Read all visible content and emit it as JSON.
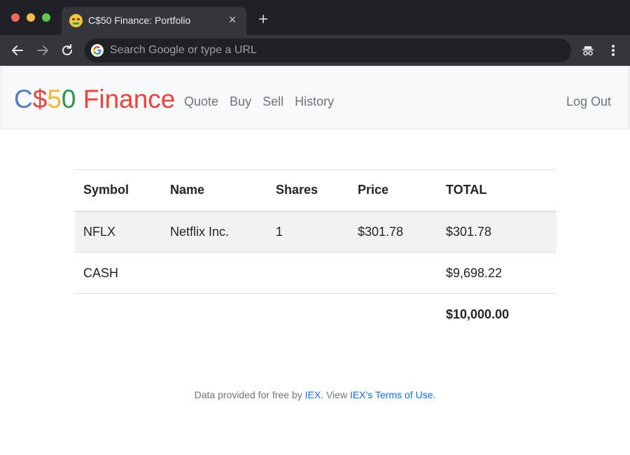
{
  "browser": {
    "tab_title": "C$50 Finance: Portfolio",
    "tab_close": "×",
    "new_tab": "+",
    "omnibox_placeholder": "Search Google or type a URL",
    "omnibox_value": ""
  },
  "brand": {
    "parts": [
      {
        "text": "C",
        "color": "#537fbe"
      },
      {
        "text": "$",
        "color": "#ea433b"
      },
      {
        "text": "5",
        "color": "#f5b82e"
      },
      {
        "text": "0",
        "color": "#2e944b"
      },
      {
        "text": " Finance",
        "color": "#ea433b"
      }
    ]
  },
  "nav": {
    "links": [
      "Quote",
      "Buy",
      "Sell",
      "History"
    ],
    "logout": "Log Out"
  },
  "table": {
    "headers": [
      "Symbol",
      "Name",
      "Shares",
      "Price",
      "TOTAL"
    ],
    "rows": [
      {
        "symbol": "NFLX",
        "name": "Netflix Inc.",
        "shares": "1",
        "price": "$301.78",
        "total": "$301.78"
      },
      {
        "symbol": "CASH",
        "name": "",
        "shares": "",
        "price": "",
        "total": "$9,698.22"
      }
    ],
    "grand_total": "$10,000.00"
  },
  "footer": {
    "prefix": "Data provided for free by ",
    "iex_link": "IEX",
    "middle": ". View ",
    "terms_link": "IEX’s Terms of Use",
    "suffix": "."
  },
  "colors": {
    "link": "#0d6efd",
    "nav_text": "#6c757d",
    "chrome_dark": "#202124",
    "chrome_toolbar": "#35363a"
  }
}
